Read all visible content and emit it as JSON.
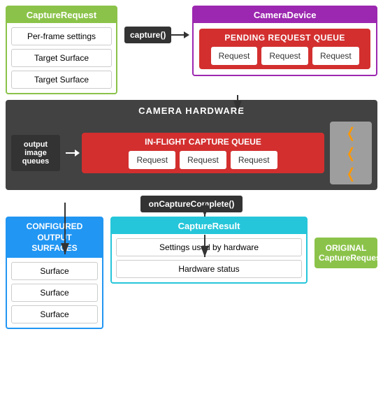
{
  "captureRequest": {
    "title": "CaptureRequest",
    "items": [
      "Per-frame settings",
      "Target Surface",
      "Target Surface"
    ]
  },
  "captureCall": "capture()",
  "cameraDevice": {
    "title": "CameraDevice",
    "pendingQueue": {
      "title": "PENDING REQUEST QUEUE",
      "requests": [
        "Request",
        "Request",
        "Request"
      ]
    }
  },
  "cameraHardware": {
    "title": "CAMERA HARDWARE",
    "outputQueuesLabel": "output image\nqueues",
    "inflightQueue": {
      "title": "IN-FLIGHT CAPTURE QUEUE",
      "requests": [
        "Request",
        "Request",
        "Request"
      ]
    }
  },
  "onCaptureComplete": "onCaptureComplete()",
  "configuredSurfaces": {
    "title": "CONFIGURED OUTPUT\nSURFACES",
    "items": [
      "Surface",
      "Surface",
      "Surface"
    ]
  },
  "captureResult": {
    "title": "CaptureResult",
    "items": [
      "Settings used by hardware",
      "Hardware status"
    ]
  },
  "originalCaptureRequest": {
    "line1": "ORIGINAL",
    "line2": "CaptureRequest"
  },
  "colors": {
    "green": "#8bc34a",
    "purple": "#9c27b0",
    "red": "#d32f2f",
    "darkGray": "#424242",
    "cyan": "#26c6da",
    "blue": "#2196f3",
    "orange": "#ff9800"
  }
}
